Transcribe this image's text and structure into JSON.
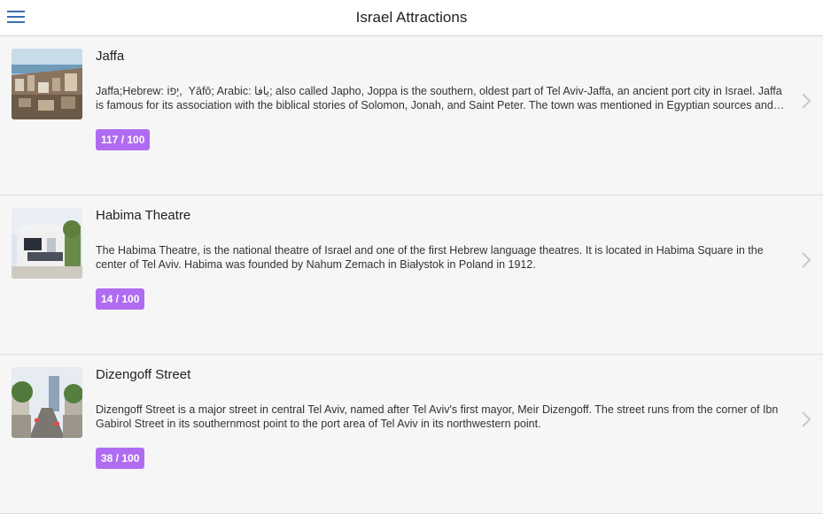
{
  "header": {
    "title": "Israel Attractions",
    "menu_icon": "hamburger-menu-icon",
    "accent": "#3a6fb0"
  },
  "badge_color": "#b06cf0",
  "attractions": [
    {
      "title": "Jaffa",
      "description": "Jaffa;Hebrew: יָפוֹ, ‎ Yāfō; Arabic: يافا‎; also called Japho, Joppa is the southern, oldest part of Tel Aviv-Jaffa, an ancient port city in Israel. Jaffa is famous for its association with the biblical stories of Solomon, Jonah, and Saint Peter. The town was mentioned in Egyptian sources and the Amarna letters.",
      "score": "117 / 100",
      "image": "jaffa-photo"
    },
    {
      "title": "Habima Theatre",
      "description": "The Habima Theatre, is the national theatre of Israel and one of the first Hebrew language theatres. It is located in Habima Square in the center of Tel Aviv. Habima was founded by Nahum Zemach in Białystok in Poland in 1912.",
      "score": "14 / 100",
      "image": "habima-theatre-photo"
    },
    {
      "title": "Dizengoff Street",
      "description": "Dizengoff Street is a major street in central Tel Aviv, named after Tel Aviv's first mayor, Meir Dizengoff. The street runs from the corner of Ibn Gabirol Street in its southernmost point to the port area of Tel Aviv in its northwestern point.",
      "score": "38 / 100",
      "image": "dizengoff-street-photo"
    }
  ]
}
